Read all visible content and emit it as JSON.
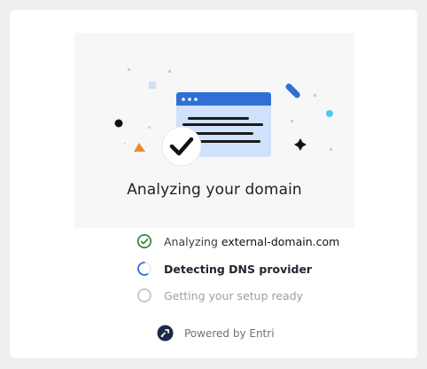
{
  "hero": {
    "title": "Analyzing your domain"
  },
  "steps": [
    {
      "status": "completed",
      "label_prefix": "Analyzing ",
      "label_value": "external-domain.com"
    },
    {
      "status": "in-progress",
      "label": "Detecting DNS provider"
    },
    {
      "status": "pending",
      "label": "Getting your setup ready"
    }
  ],
  "footer": {
    "powered_by": "Powered by Entri"
  },
  "colors": {
    "success": "#2e7d32",
    "accent": "#2f6fd6",
    "brand": "#1c2a4a",
    "muted": "#b8bcc2"
  },
  "icons": [
    "check-circle-icon",
    "spinner-icon",
    "empty-circle-icon",
    "entri-logo-icon",
    "browser-window-illustration",
    "checkmark-badge-icon"
  ]
}
